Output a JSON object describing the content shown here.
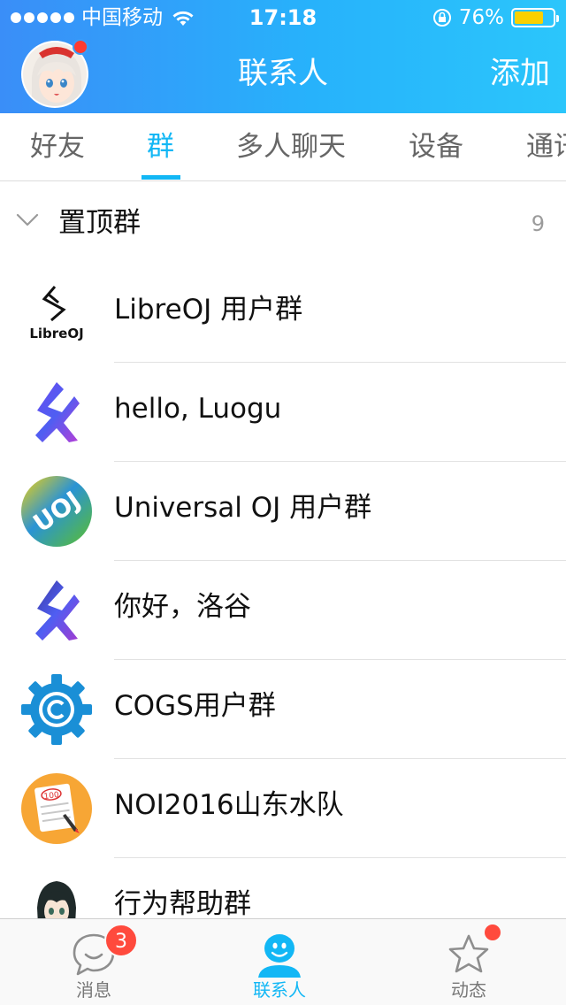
{
  "status_bar": {
    "carrier": "中国移动",
    "time": "17:18",
    "battery_percent": "76%",
    "battery_level": 0.76,
    "battery_color": "#f9d000"
  },
  "nav": {
    "title": "联系人",
    "add_label": "添加",
    "avatar_badge": "red-dot",
    "gradient": [
      "#3a8ef8",
      "#2bc6fb"
    ]
  },
  "tabs": [
    {
      "label": "好友",
      "active": false
    },
    {
      "label": "群",
      "active": true
    },
    {
      "label": "多人聊天",
      "active": false
    },
    {
      "label": "设备",
      "active": false
    },
    {
      "label": "通讯录",
      "active": false
    }
  ],
  "accent_color": "#12b7f5",
  "section": {
    "title": "置顶群",
    "count": "9",
    "icon": "chevron-down-icon"
  },
  "groups": [
    {
      "name": "LibreOJ 用户群",
      "icon": "libreoj-logo",
      "logo_text": "LibreOJ"
    },
    {
      "name": "hello, Luogu",
      "icon": "luogu-logo"
    },
    {
      "name": "Universal OJ 用户群",
      "icon": "uoj-logo",
      "logo_text": "UOJ"
    },
    {
      "name": "你好，洛谷",
      "icon": "luogu-logo"
    },
    {
      "name": "COGS用户群",
      "icon": "cogs-gear-logo"
    },
    {
      "name": "NOI2016山东水队",
      "icon": "notepad-100-icon",
      "logo_text": "100"
    },
    {
      "name": "行为帮助群",
      "icon": "anime-girl-avatar"
    }
  ],
  "tabbar": [
    {
      "label": "消息",
      "icon": "message-bubble-icon",
      "badge": "3",
      "active": false
    },
    {
      "label": "联系人",
      "icon": "contacts-person-icon",
      "active": true
    },
    {
      "label": "动态",
      "icon": "star-icon",
      "badge_dot": true,
      "active": false
    }
  ]
}
